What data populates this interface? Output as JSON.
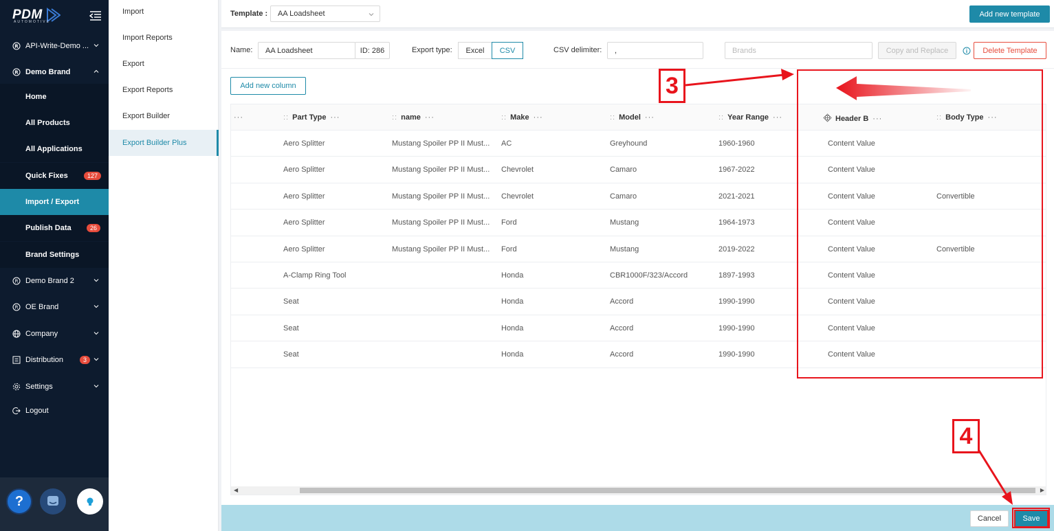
{
  "sidebar": {
    "logo_text": "PDM",
    "logo_sub": "AUTOMOTIVE",
    "items": [
      {
        "label": "API-Write-Demo ..."
      },
      {
        "label": "Demo Brand"
      },
      {
        "label": "Home"
      },
      {
        "label": "All Products"
      },
      {
        "label": "All Applications"
      },
      {
        "label": "Quick Fixes",
        "badge": "127"
      },
      {
        "label": "Import / Export"
      },
      {
        "label": "Publish Data",
        "badge": "26"
      },
      {
        "label": "Brand Settings"
      },
      {
        "label": "Demo Brand 2"
      },
      {
        "label": "OE Brand"
      },
      {
        "label": "Company"
      },
      {
        "label": "Distribution",
        "badge": "3"
      },
      {
        "label": "Settings"
      },
      {
        "label": "Logout"
      }
    ],
    "help_label": "?"
  },
  "submenu": {
    "items": [
      {
        "label": "Import"
      },
      {
        "label": "Import Reports"
      },
      {
        "label": "Export"
      },
      {
        "label": "Export Reports"
      },
      {
        "label": "Export Builder"
      },
      {
        "label": "Export Builder Plus"
      }
    ]
  },
  "topbar": {
    "template_label": "Template :",
    "template_value": "AA Loadsheet",
    "add_template_label": "Add new template"
  },
  "form": {
    "name_label": "Name:",
    "name_value": "AA Loadsheet",
    "id_label": "ID: 286",
    "export_type_label": "Export type:",
    "export_excel": "Excel",
    "export_csv": "CSV",
    "csv_delimiter_label": "CSV delimiter:",
    "csv_delimiter_value": ",",
    "brands_placeholder": "Brands",
    "copy_replace_label": "Copy and Replace",
    "delete_label": "Delete Template",
    "add_column_label": "Add new column"
  },
  "table": {
    "columns": [
      "Part Type",
      "name",
      "Make",
      "Model",
      "Year Range",
      "Header B",
      "Body Type"
    ],
    "first_col_more": "···",
    "drag_glyph": "::",
    "more_glyph": "···",
    "rows": [
      [
        "Aero Splitter",
        "Mustang Spoiler PP II Must...",
        "AC",
        "Greyhound",
        "1960-1960",
        "Content Value",
        ""
      ],
      [
        "Aero Splitter",
        "Mustang Spoiler PP II Must...",
        "Chevrolet",
        "Camaro",
        "1967-2022",
        "Content Value",
        ""
      ],
      [
        "Aero Splitter",
        "Mustang Spoiler PP II Must...",
        "Chevrolet",
        "Camaro",
        "2021-2021",
        "Content Value",
        "Convertible"
      ],
      [
        "Aero Splitter",
        "Mustang Spoiler PP II Must...",
        "Ford",
        "Mustang",
        "1964-1973",
        "Content Value",
        ""
      ],
      [
        "Aero Splitter",
        "Mustang Spoiler PP II Must...",
        "Ford",
        "Mustang",
        "2019-2022",
        "Content Value",
        "Convertible"
      ],
      [
        "A-Clamp Ring Tool",
        "",
        "Honda",
        "CBR1000F/323/Accord",
        "1897-1993",
        "Content Value",
        ""
      ],
      [
        "Seat",
        "",
        "Honda",
        "Accord",
        "1990-1990",
        "Content Value",
        ""
      ],
      [
        "Seat",
        "",
        "Honda",
        "Accord",
        "1990-1990",
        "Content Value",
        ""
      ],
      [
        "Seat",
        "",
        "Honda",
        "Accord",
        "1990-1990",
        "Content Value",
        ""
      ]
    ]
  },
  "footer": {
    "cancel_label": "Cancel",
    "save_label": "Save"
  },
  "annotations": {
    "step3": "3",
    "step4": "4"
  },
  "colors": {
    "accent": "#1e8aa8",
    "sidebar_bg": "#0d1b2e",
    "danger": "#e74c3c",
    "annotation": "#e8141c"
  }
}
